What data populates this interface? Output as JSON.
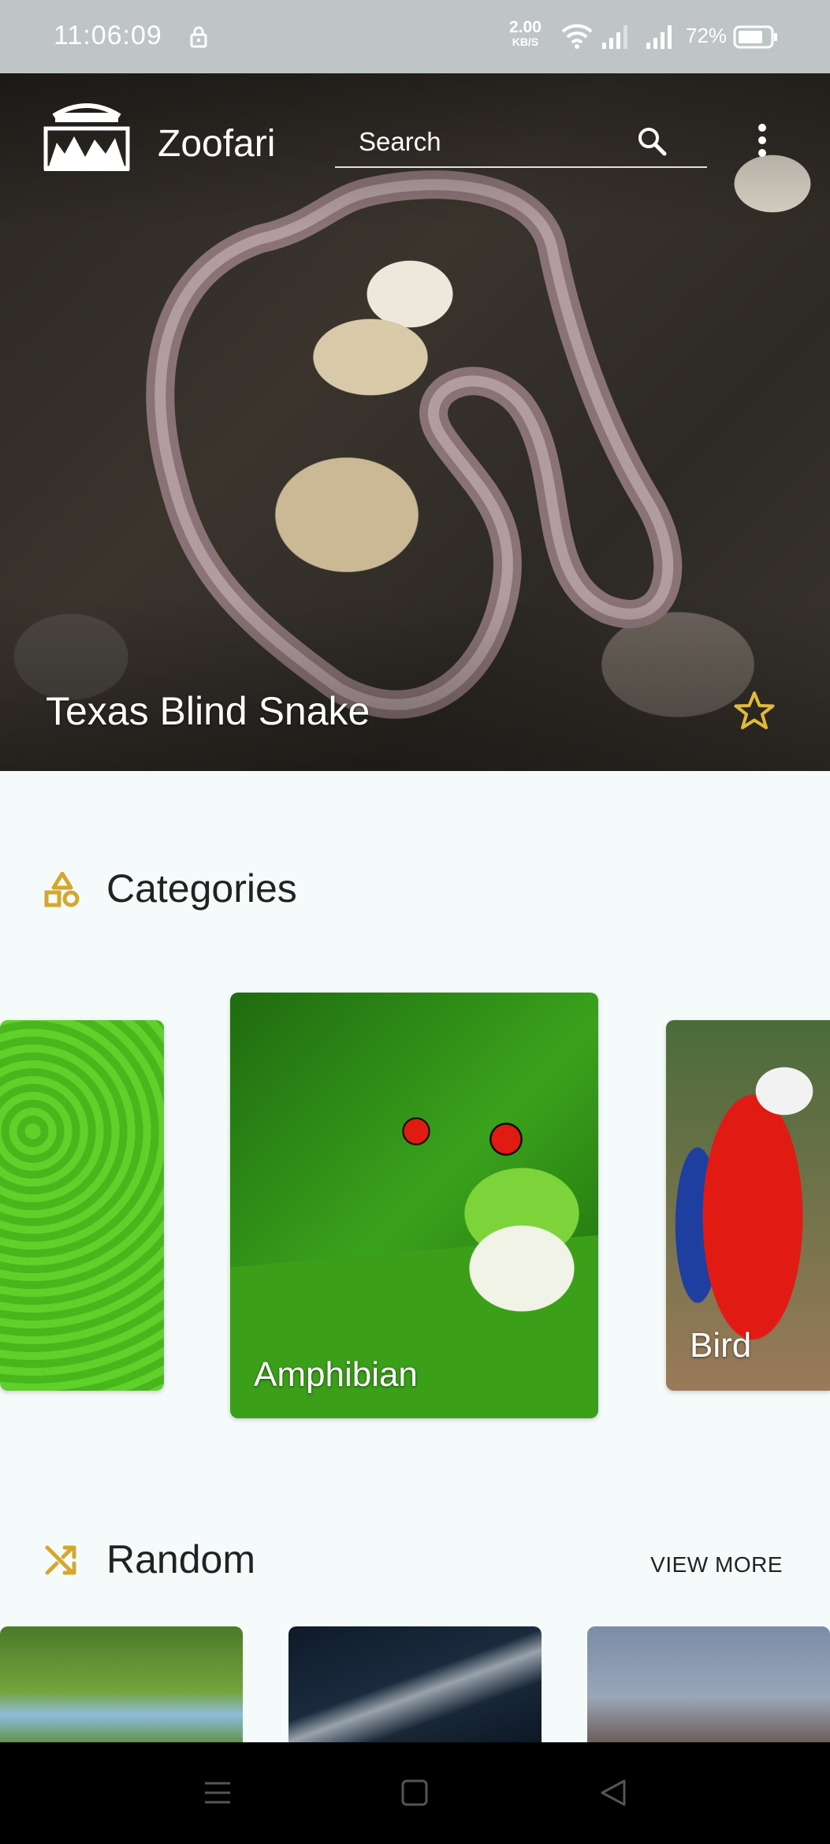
{
  "status_bar": {
    "time": "11:06:09",
    "speed_value": "2.00",
    "speed_unit": "KB/S",
    "battery": "72%"
  },
  "app": {
    "name": "Zoofari",
    "logo_text": "ZOOFARI",
    "search_placeholder": "Search"
  },
  "hero": {
    "animal_name": "Texas Blind Snake",
    "favorite_icon": "star-outline-icon",
    "accent_color": "#e2b93b"
  },
  "categories": {
    "title": "Categories",
    "icon": "shapes-icon",
    "items": [
      {
        "label": ""
      },
      {
        "label": "Amphibian"
      },
      {
        "label": "Bird"
      }
    ]
  },
  "random": {
    "title": "Random",
    "icon": "shuffle-icon",
    "view_more": "VIEW MORE"
  },
  "nav": {
    "menu_icon": "menu-icon",
    "home_icon": "home-square-icon",
    "back_icon": "back-triangle-icon"
  }
}
